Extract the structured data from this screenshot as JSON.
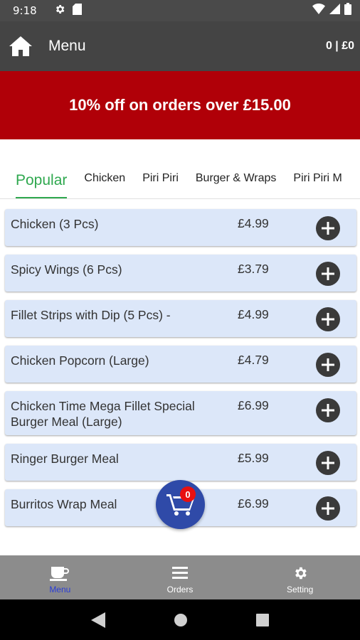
{
  "status_bar": {
    "time": "9:18"
  },
  "app_bar": {
    "title": "Menu",
    "cart_summary": "0 | £0"
  },
  "promo": {
    "text": "10% off on orders over £15.00"
  },
  "tabs": [
    {
      "label": "Popular",
      "active": true
    },
    {
      "label": "Chicken"
    },
    {
      "label": "Piri Piri"
    },
    {
      "label": "Burger & Wraps"
    },
    {
      "label": "Piri Piri M"
    }
  ],
  "menu_items": [
    {
      "name": "Chicken (3 Pcs)",
      "price": "£4.99"
    },
    {
      "name": "Spicy Wings (6 Pcs)",
      "price": "£3.79"
    },
    {
      "name": "Fillet Strips with Dip (5 Pcs) -",
      "price": "£4.99"
    },
    {
      "name": "Chicken Popcorn (Large)",
      "price": "£4.79"
    },
    {
      "name": "Chicken Time Mega Fillet Special Burger Meal (Large)",
      "price": "£6.99"
    },
    {
      "name": "Ringer Burger Meal",
      "price": "£5.99"
    },
    {
      "name": "Burritos Wrap Meal",
      "price": "£6.99"
    }
  ],
  "cart_fab": {
    "count": "0"
  },
  "bottom_nav": [
    {
      "label": "Menu",
      "icon": "coffee-cup-icon",
      "active": true
    },
    {
      "label": "Orders",
      "icon": "list-icon"
    },
    {
      "label": "Setting",
      "icon": "gear-icon"
    }
  ],
  "colors": {
    "status_bar": "#4a4a4a",
    "app_bar": "#444444",
    "promo": "#b00008",
    "accent_green": "#2fa84f",
    "item_bg": "#dce7f9",
    "fab": "#2f4aa8",
    "bottom_nav": "#8c8c8c"
  }
}
